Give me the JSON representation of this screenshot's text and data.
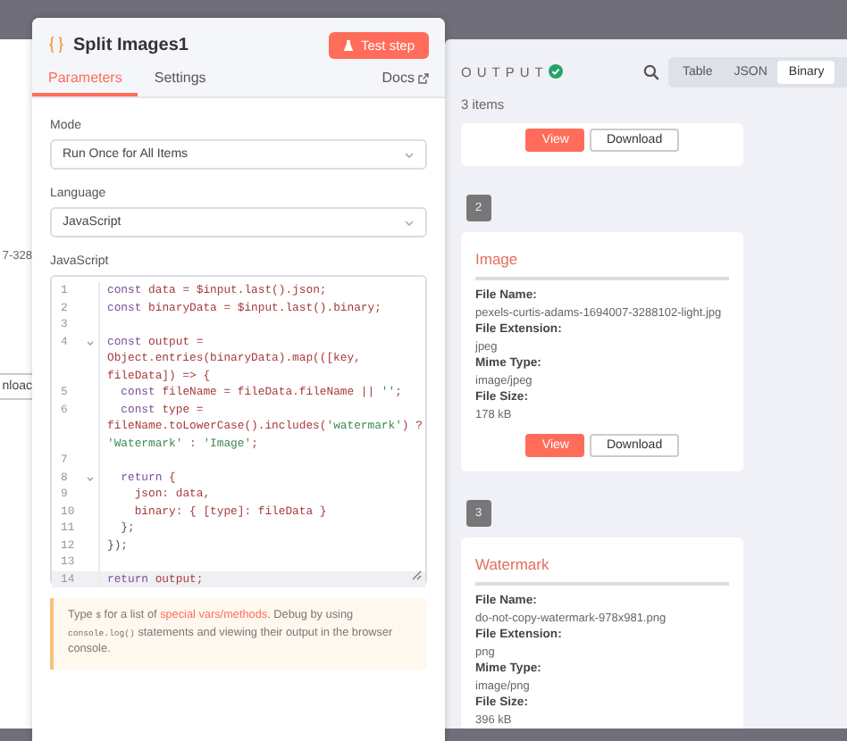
{
  "background": {
    "fragments": [
      {
        "kind": "text",
        "text": "7-328"
      },
      {
        "kind": "button",
        "text": "nloac"
      }
    ]
  },
  "node_panel": {
    "title": "Split Images1",
    "test_button": "Test step",
    "tabs": [
      {
        "label": "Parameters",
        "selected": true
      },
      {
        "label": "Settings",
        "selected": false
      }
    ],
    "docs_link": "Docs",
    "fields": [
      {
        "label": "Mode",
        "value": "Run Once for All Items"
      },
      {
        "label": "Language",
        "value": "JavaScript"
      }
    ],
    "code_label": "JavaScript",
    "code_lines": [
      {
        "number": "1",
        "fold": false,
        "active": false,
        "parts": [
          {
            "kind": "keyword",
            "text": "const"
          },
          {
            "kind": "name",
            "text": " data = $input.last().json;"
          }
        ]
      },
      {
        "number": "2",
        "fold": false,
        "active": false,
        "parts": [
          {
            "kind": "keyword",
            "text": "const"
          },
          {
            "kind": "name",
            "text": " binaryData = $input.last().binary;"
          }
        ]
      },
      {
        "number": "3",
        "fold": false,
        "active": false
      },
      {
        "number": "4",
        "fold": true,
        "active": false,
        "parts": [
          {
            "kind": "keyword",
            "text": "const"
          },
          {
            "kind": "name",
            "text": " output = Object.entries(binaryData).map(([key, fileData]) => {"
          }
        ]
      },
      {
        "number": "5",
        "fold": false,
        "active": false,
        "parts": [
          {
            "kind": "keyword",
            "text": "  const"
          },
          {
            "kind": "name",
            "text": " fileName = fileData.fileName || "
          },
          {
            "kind": "string",
            "text": "''"
          },
          {
            "kind": "name",
            "text": ";"
          }
        ]
      },
      {
        "number": "6",
        "fold": false,
        "active": false,
        "parts": [
          {
            "kind": "keyword",
            "text": "  const"
          },
          {
            "kind": "name",
            "text": " type = fileName.toLowerCase().includes("
          },
          {
            "kind": "string",
            "text": "'watermark'"
          },
          {
            "kind": "name",
            "text": ") ? "
          },
          {
            "kind": "string",
            "text": "'Watermark'"
          },
          {
            "kind": "name",
            "text": " : "
          },
          {
            "kind": "string",
            "text": "'Image'"
          },
          {
            "kind": "name",
            "text": ";"
          }
        ]
      },
      {
        "number": "7",
        "fold": false,
        "active": false
      },
      {
        "number": "8",
        "fold": true,
        "active": false,
        "parts": [
          {
            "kind": "keyword",
            "text": "  return"
          },
          {
            "kind": "name",
            "text": " {"
          }
        ]
      },
      {
        "number": "9",
        "fold": false,
        "active": false,
        "parts": [
          {
            "kind": "name",
            "text": "    json: data,"
          }
        ]
      },
      {
        "number": "10",
        "fold": false,
        "active": false,
        "parts": [
          {
            "kind": "name",
            "text": "    binary: { [type]: fileData }"
          }
        ]
      },
      {
        "number": "11",
        "fold": false,
        "active": false,
        "parts": [
          {
            "kind": "plain",
            "text": "  };"
          }
        ]
      },
      {
        "number": "12",
        "fold": false,
        "active": false,
        "parts": [
          {
            "kind": "plain",
            "text": "});"
          }
        ]
      },
      {
        "number": "13",
        "fold": false,
        "active": false
      },
      {
        "number": "14",
        "fold": false,
        "active": true,
        "parts": [
          {
            "kind": "keyword",
            "text": "return"
          },
          {
            "kind": "name",
            "text": " output;"
          }
        ]
      }
    ],
    "hint": [
      {
        "kind": "text",
        "text": "Type "
      },
      {
        "kind": "code",
        "text": "$"
      },
      {
        "kind": "text",
        "text": " for a list of "
      },
      {
        "kind": "link",
        "text": "special vars/methods"
      },
      {
        "kind": "text",
        "text": ". Debug by using "
      },
      {
        "kind": "code",
        "text": "console.log()"
      },
      {
        "kind": "text",
        "text": " statements and viewing their output in the browser console."
      }
    ]
  },
  "output": {
    "title": "OUTPUT",
    "success": true,
    "view_tabs": [
      {
        "label": "Table",
        "selected": false
      },
      {
        "label": "JSON",
        "selected": false
      },
      {
        "label": "Binary",
        "selected": true
      }
    ],
    "items_count": "3 items",
    "items": [
      {
        "buttons": [
          "View",
          "Download"
        ]
      },
      {
        "badge": "2",
        "title": "Image",
        "fields": [
          {
            "label": "File Name:",
            "value": "pexels-curtis-adams-1694007-3288102-light.jpg"
          },
          {
            "label": "File Extension:",
            "value": "jpeg"
          },
          {
            "label": "Mime Type:",
            "value": "image/jpeg"
          },
          {
            "label": "File Size:",
            "value": "178 kB"
          }
        ],
        "buttons": [
          "View",
          "Download"
        ]
      },
      {
        "badge": "3",
        "title": "Watermark",
        "fields": [
          {
            "label": "File Name:",
            "value": "do-not-copy-watermark-978x981.png"
          },
          {
            "label": "File Extension:",
            "value": "png"
          },
          {
            "label": "Mime Type:",
            "value": "image/png"
          },
          {
            "label": "File Size:",
            "value": "396 kB"
          }
        ]
      }
    ]
  }
}
